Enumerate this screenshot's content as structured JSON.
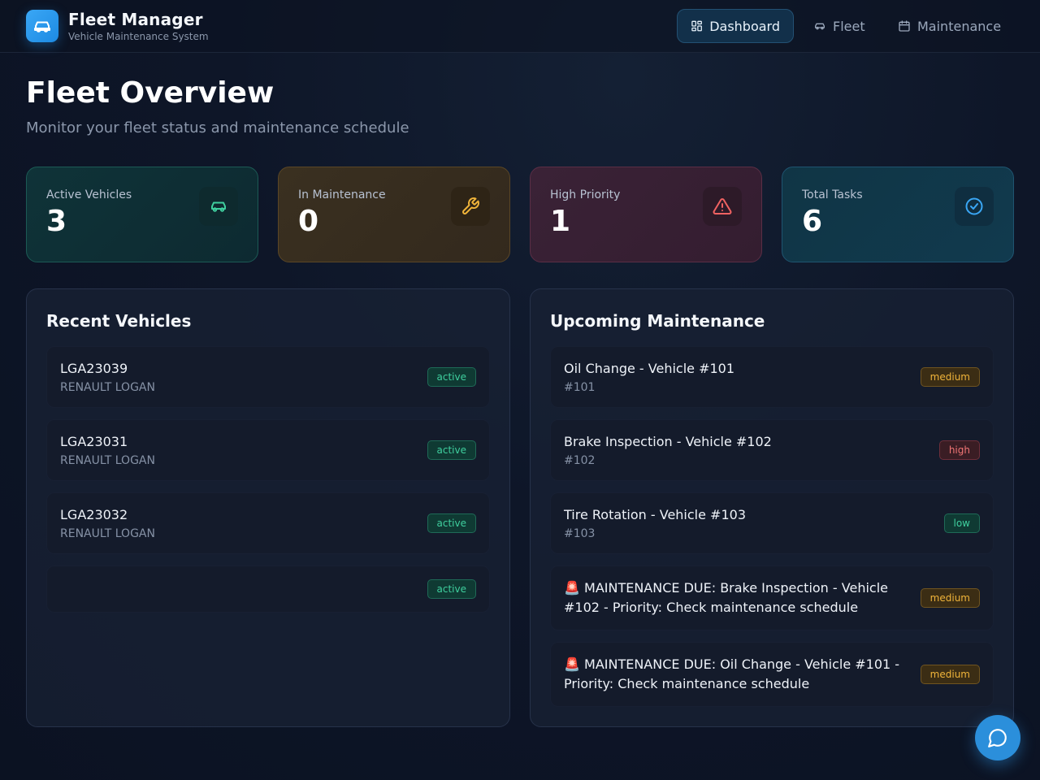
{
  "app": {
    "title": "Fleet Manager",
    "subtitle": "Vehicle Maintenance System"
  },
  "nav": {
    "items": [
      {
        "label": "Dashboard",
        "icon": "grid-icon",
        "active": true
      },
      {
        "label": "Fleet",
        "icon": "car-icon",
        "active": false
      },
      {
        "label": "Maintenance",
        "icon": "calendar-icon",
        "active": false
      }
    ]
  },
  "page": {
    "title": "Fleet Overview",
    "subtitle": "Monitor your fleet status and maintenance schedule"
  },
  "stats": [
    {
      "label": "Active Vehicles",
      "value": "3",
      "icon": "car-icon",
      "color": "#3fcf9e"
    },
    {
      "label": "In Maintenance",
      "value": "0",
      "icon": "wrench-icon",
      "color": "#f0b43a"
    },
    {
      "label": "High Priority",
      "value": "1",
      "icon": "alert-triangle-icon",
      "color": "#f06262"
    },
    {
      "label": "Total Tasks",
      "value": "6",
      "icon": "check-circle-icon",
      "color": "#3aa7f5"
    }
  ],
  "recent_vehicles": {
    "title": "Recent Vehicles",
    "items": [
      {
        "plate": "LGA23039",
        "model": "RENAULT LOGAN",
        "status": "active"
      },
      {
        "plate": "LGA23031",
        "model": "RENAULT LOGAN",
        "status": "active"
      },
      {
        "plate": "LGA23032",
        "model": "RENAULT LOGAN",
        "status": "active"
      },
      {
        "plate": "",
        "model": "",
        "status": "active"
      }
    ]
  },
  "upcoming_maintenance": {
    "title": "Upcoming Maintenance",
    "items": [
      {
        "title": "Oil Change - Vehicle #101",
        "ref": "#101",
        "priority": "medium"
      },
      {
        "title": "Brake Inspection - Vehicle #102",
        "ref": "#102",
        "priority": "high"
      },
      {
        "title": "Tire Rotation - Vehicle #103",
        "ref": "#103",
        "priority": "low"
      },
      {
        "title": "🚨 MAINTENANCE DUE: Brake Inspection - Vehicle #102 - Priority: Check maintenance schedule",
        "ref": "",
        "priority": "medium"
      },
      {
        "title": "🚨 MAINTENANCE DUE: Oil Change - Vehicle #101 - Priority: Check maintenance schedule",
        "ref": "",
        "priority": "medium"
      }
    ]
  },
  "colors": {
    "accent": "#2b8fdb",
    "background": "#0e1628",
    "active": "#3fcf9e",
    "medium": "#f0b43a",
    "high": "#f07575"
  }
}
